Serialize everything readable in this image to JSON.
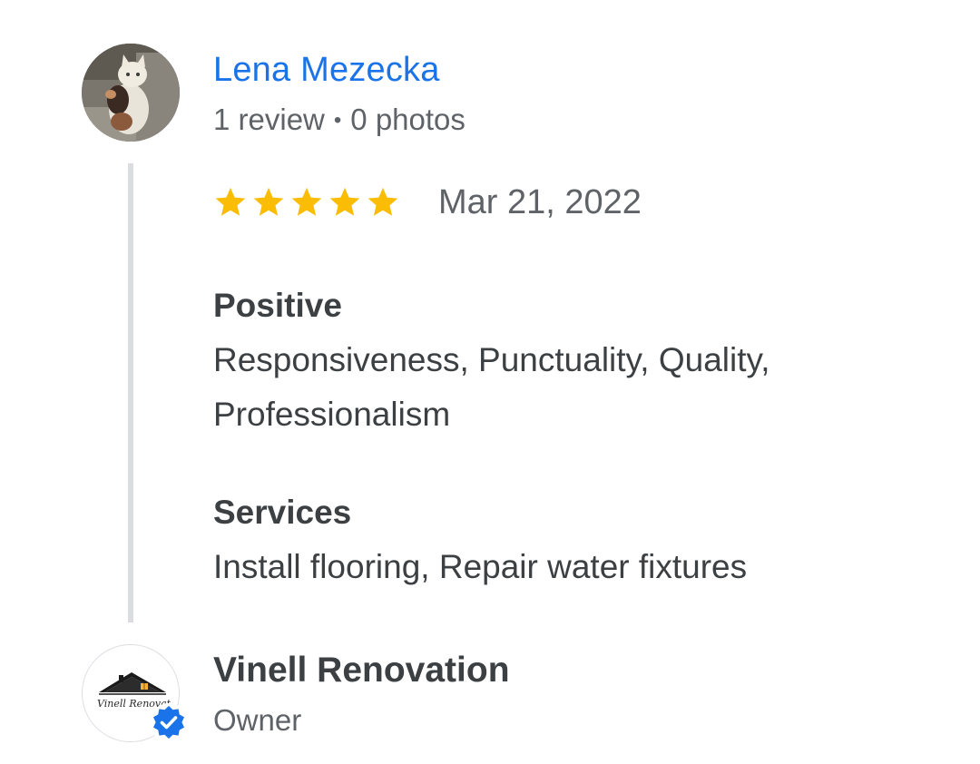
{
  "reviewer": {
    "name": "Lena Mezecka",
    "reviews_count": "1 review",
    "separator": "•",
    "photos_count": "0 photos",
    "avatar_icon": "cat-photo-avatar"
  },
  "review": {
    "rating": 5,
    "rating_max": 5,
    "star_color": "#fbbc04",
    "date": "Mar 21, 2022",
    "sections": [
      {
        "title": "Positive",
        "body": "Responsiveness, Punctuality, Quality, Professionalism"
      },
      {
        "title": "Services",
        "body": "Install flooring, Repair water fixtures"
      }
    ]
  },
  "owner": {
    "name": "Vinell Renovation",
    "role": "Owner",
    "logo_text": "Vinell Renovat",
    "verified_icon": "verified-badge-icon",
    "badge_color": "#1a73e8"
  },
  "colors": {
    "link": "#1a73e8",
    "text_primary": "#3c4043",
    "text_secondary": "#5f6368",
    "thread_line": "#dadce0"
  }
}
